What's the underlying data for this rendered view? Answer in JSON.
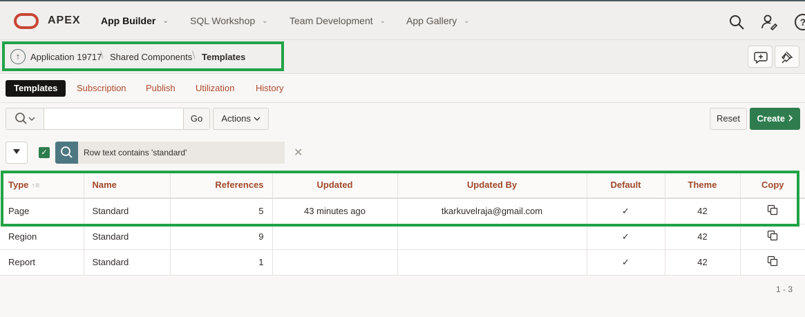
{
  "topnav": {
    "brand": "APEX",
    "items": [
      {
        "label": "App Builder",
        "active": true
      },
      {
        "label": "SQL Workshop",
        "active": false
      },
      {
        "label": "Team Development",
        "active": false
      },
      {
        "label": "App Gallery",
        "active": false
      }
    ],
    "help_glyph": "?",
    "icons": [
      "search-icon",
      "user-settings-icon",
      "help-icon"
    ]
  },
  "breadcrumb": {
    "up_glyph": "↑",
    "items": [
      "Application 19717",
      "Shared Components",
      "Templates"
    ]
  },
  "tabs": [
    {
      "label": "Templates",
      "active": true
    },
    {
      "label": "Subscription"
    },
    {
      "label": "Publish"
    },
    {
      "label": "Utilization"
    },
    {
      "label": "History"
    }
  ],
  "toolbar": {
    "search_value": "",
    "go_label": "Go",
    "actions_label": "Actions",
    "reset_label": "Reset",
    "create_label": "Create"
  },
  "filter": {
    "text": "Row text contains 'standard'",
    "enabled": true
  },
  "table": {
    "columns": [
      "Type",
      "Name",
      "References",
      "Updated",
      "Updated By",
      "Default",
      "Theme",
      "Copy"
    ],
    "rows": [
      {
        "type": "Page",
        "name": "Standard",
        "references": "5",
        "updated": "43 minutes ago",
        "updated_by": "tkarkuvelraja@gmail.com",
        "default": "✓",
        "theme": "42"
      },
      {
        "type": "Region",
        "name": "Standard",
        "references": "9",
        "updated": "",
        "updated_by": "",
        "default": "✓",
        "theme": "42"
      },
      {
        "type": "Report",
        "name": "Standard",
        "references": "1",
        "updated": "",
        "updated_by": "",
        "default": "✓",
        "theme": "42"
      }
    ]
  },
  "pagination": "1 - 3",
  "colors": {
    "brand_red": "#c74634",
    "link": "#b04a2d",
    "create_green": "#2f7d4f",
    "highlight_green": "#21a347",
    "filter_teal": "#4d7782"
  }
}
